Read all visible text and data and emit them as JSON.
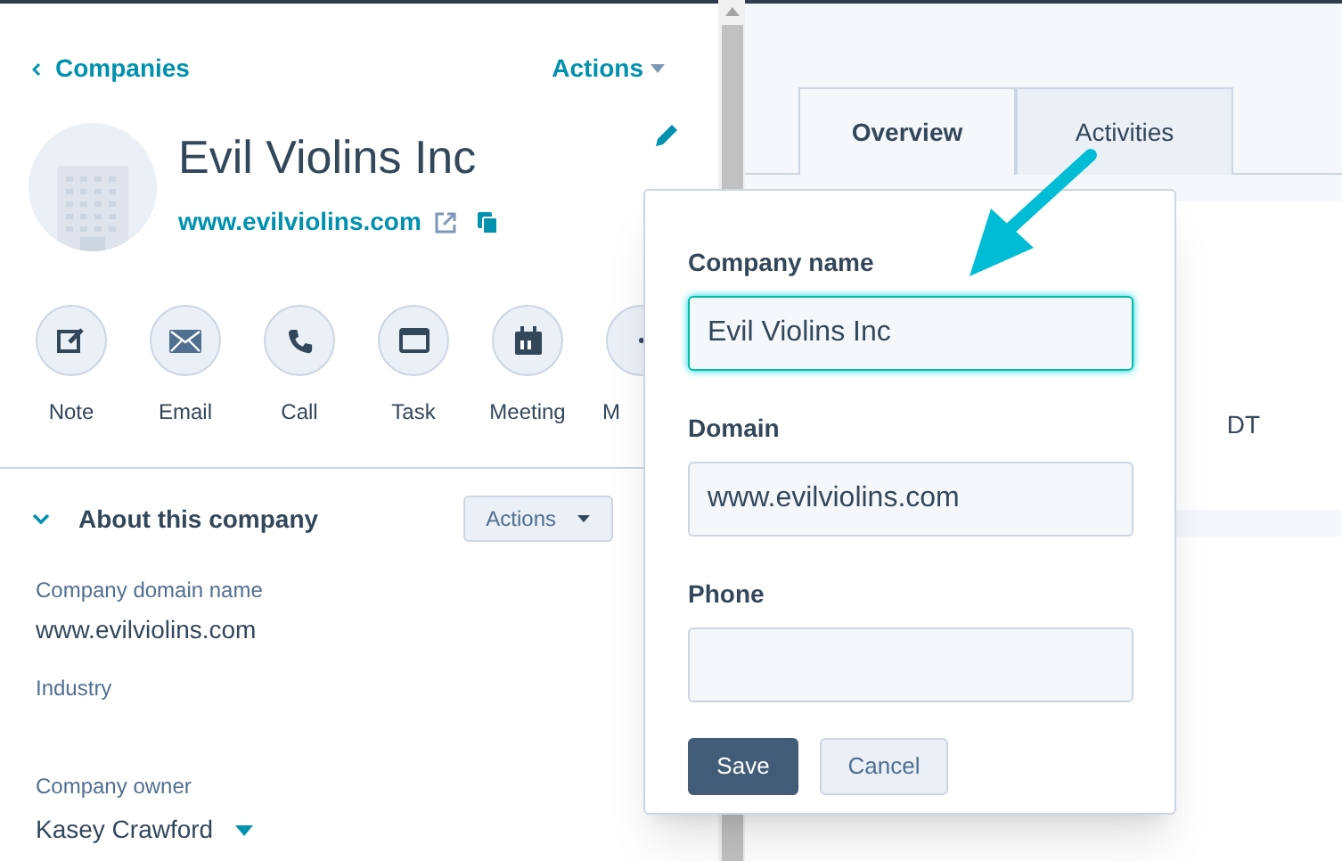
{
  "header": {
    "back_link": "Companies",
    "actions_menu": "Actions"
  },
  "company": {
    "name": "Evil Violins Inc",
    "domain": "www.evilviolins.com"
  },
  "quick_actions": [
    {
      "label": "Note",
      "kind": "note"
    },
    {
      "label": "Email",
      "kind": "email"
    },
    {
      "label": "Call",
      "kind": "call"
    },
    {
      "label": "Task",
      "kind": "task"
    },
    {
      "label": "Meeting",
      "kind": "meeting"
    },
    {
      "label": "M",
      "kind": "more"
    }
  ],
  "about": {
    "title": "About this company",
    "expanded": true,
    "actions_button": "Actions",
    "properties": [
      {
        "label": "Company domain name",
        "value": "www.evilviolins.com",
        "kind": "text"
      },
      {
        "label": "Industry"
      },
      {
        "label": "Company owner",
        "value": "Kasey Crawford",
        "kind": "dropdown"
      }
    ]
  },
  "tabs": [
    {
      "label": "Overview",
      "selected": true
    },
    {
      "label": "Activities",
      "selected": false
    }
  ],
  "right_panel": {
    "column_1": "DT"
  },
  "edit_popover": {
    "fields": [
      {
        "label": "Company name",
        "value": "Evil Violins Inc",
        "focused": true
      },
      {
        "label": "Domain",
        "value": "www.evilviolins.com",
        "focused": false
      },
      {
        "label": "Phone",
        "focused": false
      }
    ],
    "buttons": [
      {
        "label": "Save",
        "kind": "primary"
      },
      {
        "label": "Cancel",
        "kind": "secondary"
      }
    ]
  }
}
